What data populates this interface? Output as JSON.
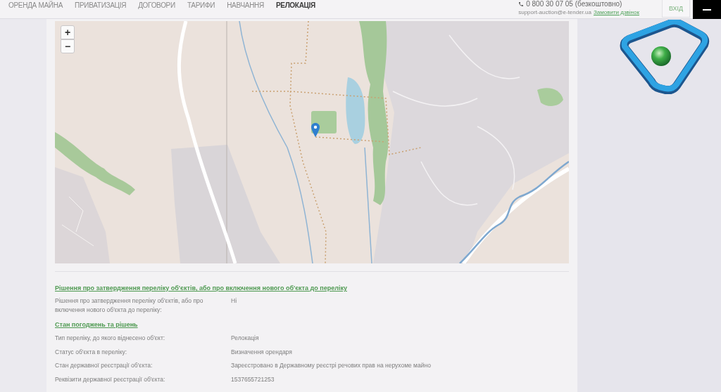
{
  "header": {
    "nav": [
      {
        "label": "ОРЕНДА МАЙНА",
        "selected": false
      },
      {
        "label": "ПРИВАТИЗАЦІЯ",
        "selected": false
      },
      {
        "label": "ДОГОВОРИ",
        "selected": false
      },
      {
        "label": "ТАРИФИ",
        "selected": false
      },
      {
        "label": "НАВЧАННЯ",
        "selected": false
      },
      {
        "label": "РЕЛОКАЦІЯ",
        "selected": true
      }
    ],
    "phone": "0 800 30 07 05 (безкоштовно)",
    "email": "support-auction@e-tender.ua",
    "callback_link": "Замовити дзвінок",
    "login_button": "ВХІД"
  },
  "map": {
    "zoom_in": "+",
    "zoom_out": "−"
  },
  "sections": [
    {
      "heading": "Рішення про затвердження переліку об'єктів, або про включення нового об'єкта до переліку",
      "rows": [
        {
          "label": "Рішення про затвердження переліку об'єктів, або про включення нового об'єкта до переліку:",
          "value": "Ні"
        }
      ]
    },
    {
      "heading": "Стан погоджень та рішень",
      "rows": [
        {
          "label": "Тип переліку, до якого віднесено об'єкт:",
          "value": "Релокація"
        },
        {
          "label": "Статус об'єкта в переліку:",
          "value": "Визначення орендаря"
        },
        {
          "label": "Стан державної реєстрації об'єкта:",
          "value": "Зареєстровано в Державному реєстрі речових прав на нерухоме майно"
        },
        {
          "label": "Реквізити державної реєстрації об'єкта:",
          "value": "1537655721253"
        }
      ]
    }
  ]
}
